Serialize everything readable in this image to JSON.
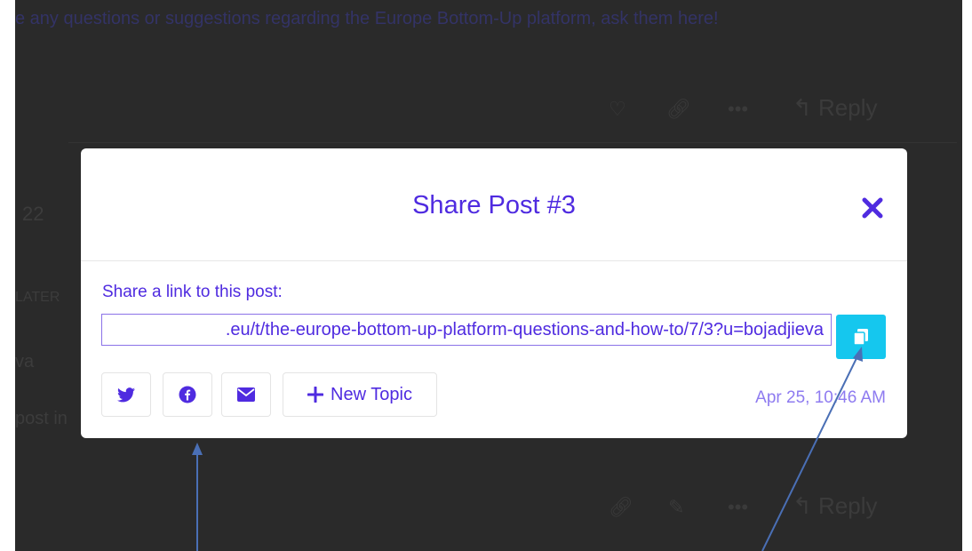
{
  "background": {
    "top_text": "e any questions or suggestions regarding the Europe Bottom-Up platform, ask them here!",
    "number_fragment": "22",
    "later_fragment": "LATER",
    "name_fragment": "va",
    "post_fragment": "post in",
    "reply_label_top": "Reply",
    "reply_label_bottom": "Reply"
  },
  "modal": {
    "title": "Share Post #3",
    "share_label": "Share a link to this post:",
    "link_value": ".eu/t/the-europe-bottom-up-platform-questions-and-how-to/7/3?u=bojadjieva",
    "new_topic_label": "New Topic",
    "date": "Apr 25, 10:46 AM"
  },
  "colors": {
    "accent": "#4f2be0",
    "copy_button": "#15c7ee",
    "arrow": "#4a6fb5"
  },
  "icons": {
    "close": "close-icon",
    "copy": "copy-icon",
    "twitter": "twitter-icon",
    "facebook": "facebook-icon",
    "email": "envelope-icon",
    "plus": "plus-icon"
  }
}
